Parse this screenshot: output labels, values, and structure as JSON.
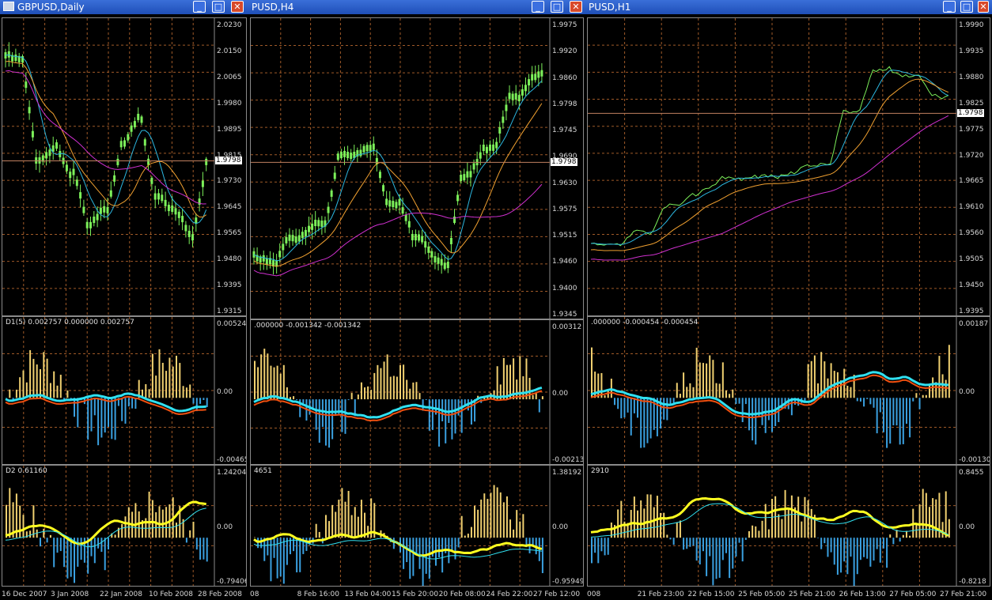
{
  "windows": [
    {
      "title": "GBPUSD,Daily",
      "price_axis": [
        "2.0230",
        "2.0150",
        "2.0065",
        "1.9980",
        "1.9895",
        "1.9815",
        "1.9730",
        "1.9645",
        "1.9565",
        "1.9480",
        "1.9395",
        "1.9315"
      ],
      "current_price": "1.9798",
      "ind1_label": "D1(5) 0.002757 0.000000 0.002757",
      "ind1_axis": [
        "0.00524",
        "0.00",
        "-0.00465"
      ],
      "ind2_label": "D2 0.61160",
      "ind2_axis": [
        "1.24204",
        "0.00",
        "-0.79406"
      ],
      "dates": [
        "16 Dec 2007",
        "3 Jan 2008",
        "22 Jan 2008",
        "10 Feb 2008",
        "28 Feb 2008"
      ]
    },
    {
      "title": "PUSD,H4",
      "price_axis": [
        "1.9975",
        "1.9920",
        "1.9860",
        "1.9798",
        "1.9745",
        "1.9690",
        "1.9630",
        "1.9575",
        "1.9515",
        "1.9460",
        "1.9400",
        "1.9345"
      ],
      "current_price": "1.9798",
      "ind1_label": ".000000 -0.001342 -0.001342",
      "ind1_axis": [
        "0.00312",
        "0.00",
        "-0.00213"
      ],
      "ind2_label": "4651",
      "ind2_axis": [
        "1.38192",
        "0.00",
        "-0.95949"
      ],
      "dates": [
        "08",
        "8 Feb 16:00",
        "13 Feb 04:00",
        "15 Feb 20:00",
        "20 Feb 08:00",
        "24 Feb 22:00",
        "27 Feb 12:00"
      ]
    },
    {
      "title": "PUSD,H1",
      "price_axis": [
        "1.9990",
        "1.9935",
        "1.9880",
        "1.9825",
        "1.9775",
        "1.9720",
        "1.9665",
        "1.9610",
        "1.9560",
        "1.9505",
        "1.9450",
        "1.9395"
      ],
      "current_price": "1.9798",
      "ind1_label": ".000000 -0.000454 -0.000454",
      "ind1_axis": [
        "0.00187",
        "0.00",
        "-0.00130"
      ],
      "ind2_label": "2910",
      "ind2_axis": [
        "0.8455",
        "0.00",
        "-0.8218"
      ],
      "dates": [
        "008",
        "21 Feb 23:00",
        "22 Feb 15:00",
        "25 Feb 05:00",
        "25 Feb 21:00",
        "26 Feb 13:00",
        "27 Feb 05:00",
        "27 Feb 21:00"
      ]
    }
  ],
  "buttons": {
    "minimize": "_",
    "maximize": "□",
    "close": "✕"
  },
  "colors": {
    "candle": "#7cf05a",
    "fast_ma": "#2cb7e0",
    "slow_ma": "#f0a030",
    "ma_magenta": "#d030d0",
    "ma_yellow": "#e8d060",
    "hist_pos": "#f0d070",
    "hist_neg": "#3aa0e0",
    "osc_cyan": "#30e0f0",
    "osc_orange": "#f05010",
    "yellow_line": "#ffff20",
    "grid": "#a05a28",
    "price_line": "#c08060"
  }
}
